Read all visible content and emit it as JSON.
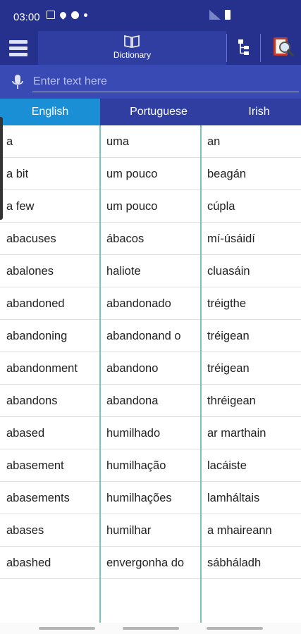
{
  "status_bar": {
    "time": "03:00"
  },
  "toolbar": {
    "dictionary_label": "Dictionary"
  },
  "search": {
    "placeholder": "Enter text here",
    "value": ""
  },
  "languages": [
    {
      "label": "English",
      "active": true
    },
    {
      "label": "Portuguese",
      "active": false
    },
    {
      "label": "Irish",
      "active": false
    }
  ],
  "rows": [
    [
      "a",
      "uma",
      "an"
    ],
    [
      "a bit",
      "um pouco",
      "beagán"
    ],
    [
      "a few",
      "um pouco",
      "cúpla"
    ],
    [
      "abacuses",
      "ábacos",
      "mí-úsáidí"
    ],
    [
      "abalones",
      "haliote",
      "cluasáin"
    ],
    [
      "abandoned",
      "abandonado",
      "tréigthe"
    ],
    [
      "abandoning",
      "abandonand o",
      "tréigean"
    ],
    [
      "abandonment",
      "abandono",
      "tréigean"
    ],
    [
      "abandons",
      "abandona",
      "thréigean"
    ],
    [
      "abased",
      "humilhado",
      "ar marthain"
    ],
    [
      "abasement",
      "humilhação",
      "lacáiste"
    ],
    [
      "abasements",
      "humilhações",
      "lamháltais"
    ],
    [
      "abases",
      "humilhar",
      "a mhaireann"
    ],
    [
      "abashed",
      "envergonha do",
      "sábháladh"
    ]
  ],
  "colors": {
    "toolbar": "#25318c",
    "input_bar": "#3a4ab5",
    "active_tab": "#1a8fd6",
    "column_divider": "#7cc3b7"
  },
  "icons": [
    "menu-icon",
    "book-icon",
    "tree-icon",
    "search-book-icon",
    "mic-icon"
  ]
}
